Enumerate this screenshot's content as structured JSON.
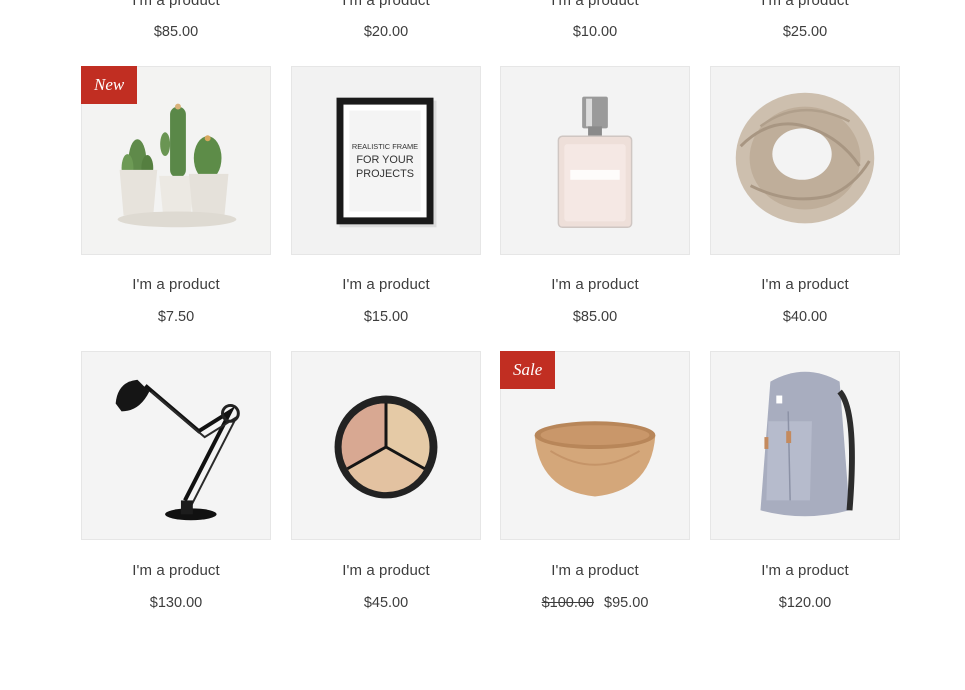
{
  "top_row": [
    {
      "name": "I'm a product",
      "price": "$85.00"
    },
    {
      "name": "I'm a product",
      "price": "$20.00"
    },
    {
      "name": "I'm a product",
      "price": "$10.00"
    },
    {
      "name": "I'm a product",
      "price": "$25.00"
    }
  ],
  "row2": [
    {
      "name": "I'm a product",
      "price": "$7.50",
      "ribbon": "New",
      "image": "cactus-plant-pot"
    },
    {
      "name": "I'm a product",
      "price": "$15.00",
      "image": "picture-frame",
      "frame_text": [
        "REALISTIC FRAME",
        "FOR YOUR",
        "PROJECTS"
      ]
    },
    {
      "name": "I'm a product",
      "price": "$85.00",
      "image": "perfume-bottle"
    },
    {
      "name": "I'm a product",
      "price": "$40.00",
      "image": "knit-scarf"
    }
  ],
  "row3": [
    {
      "name": "I'm a product",
      "price": "$130.00",
      "image": "desk-lamp"
    },
    {
      "name": "I'm a product",
      "price": "$45.00",
      "image": "concealer-palette"
    },
    {
      "name": "I'm a product",
      "price": "$95.00",
      "old_price": "$100.00",
      "ribbon": "Sale",
      "image": "wooden-bowl"
    },
    {
      "name": "I'm a product",
      "price": "$120.00",
      "image": "backpack"
    }
  ],
  "colors": {
    "ribbon": "#c12e22",
    "text": "#3d3d3d",
    "image_bg": "#f1f1f1"
  }
}
